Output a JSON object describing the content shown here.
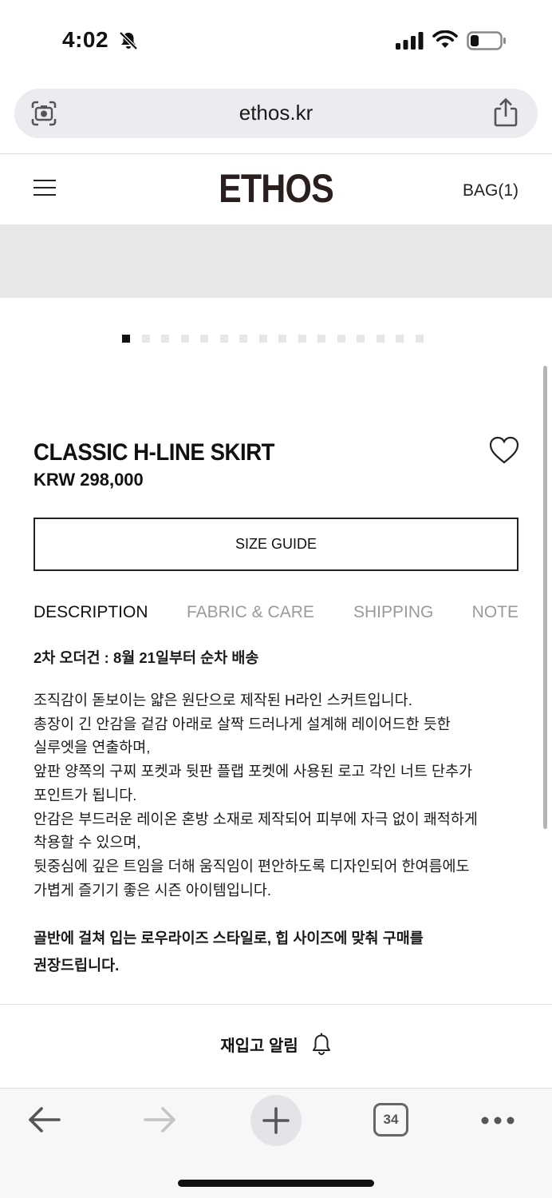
{
  "status_bar": {
    "time": "4:02",
    "icons": [
      "bell-slash-icon",
      "cellular-signal-icon",
      "wifi-icon",
      "battery-low-icon"
    ]
  },
  "browser": {
    "url": "ethos.kr",
    "icons": [
      "camera-lens-icon",
      "share-icon"
    ]
  },
  "header": {
    "logo": "ETHOS",
    "bag_label": "BAG(1)",
    "icons": [
      "hamburger-menu-icon"
    ]
  },
  "gallery": {
    "total_images": 16,
    "current_index": 1
  },
  "product": {
    "title": "CLASSIC H-LINE SKIRT",
    "price": "KRW 298,000",
    "size_guide_label": "SIZE GUIDE",
    "icons": [
      "heart-outline-icon"
    ]
  },
  "tabs": [
    {
      "label": "DESCRIPTION",
      "active": true
    },
    {
      "label": "FABRIC & CARE",
      "active": false
    },
    {
      "label": "SHIPPING",
      "active": false
    },
    {
      "label": "NOTE",
      "active": false
    }
  ],
  "description": {
    "headline": "2차 오더건 : 8월 21일부터 순차 배송",
    "lines": [
      "조직감이 돋보이는 얇은 원단으로 제작된 H라인 스커트입니다.",
      "총장이 긴 안감을 겉감 아래로 살짝 드러나게 설계해 레이어드한 듯한",
      "실루엣을 연출하며,",
      "앞판 양쪽의 구찌 포켓과 뒷판 플랩 포켓에 사용된 로고 각인 너트 단추가",
      "포인트가 됩니다.",
      "안감은 부드러운 레이온 혼방 소재로 제작되어 피부에 자극 없이 쾌적하게",
      "착용할 수 있으며,",
      "뒷중심에 깊은 트임을 더해 움직임이 편안하도록 디자인되어 한여름에도",
      "가볍게 즐기기 좋은 시즌 아이템입니다."
    ],
    "note_lines": [
      "골반에 걸쳐 입는 로우라이즈 스타일로, 힙 사이즈에 맞춰 구매를",
      "권장드립니다."
    ]
  },
  "restock": {
    "label": "재입고 알림",
    "icon": "bell-icon"
  },
  "toolbar": {
    "tab_count": "34",
    "icons": [
      "back-arrow-icon",
      "forward-arrow-icon",
      "plus-icon",
      "tabs-icon",
      "more-dots-icon"
    ]
  }
}
